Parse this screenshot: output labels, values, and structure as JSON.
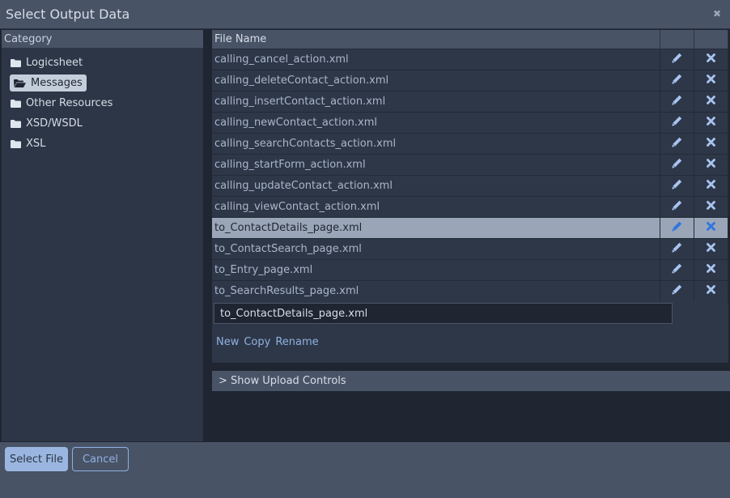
{
  "dialog": {
    "title": "Select Output Data",
    "close_icon": "close-x-icon"
  },
  "category_panel": {
    "header": "Category",
    "items": [
      {
        "label": "Logicsheet",
        "icon": "folder-icon",
        "active": false
      },
      {
        "label": "Messages",
        "icon": "folder-open-icon",
        "active": true
      },
      {
        "label": "Other Resources",
        "icon": "folder-icon",
        "active": false
      },
      {
        "label": "XSD/WSDL",
        "icon": "folder-icon",
        "active": false
      },
      {
        "label": "XSL",
        "icon": "folder-icon",
        "active": false
      }
    ]
  },
  "file_table": {
    "columns": [
      "File Name",
      "",
      ""
    ],
    "rows": [
      {
        "name": "calling_cancel_action.xml",
        "selected": false
      },
      {
        "name": "calling_deleteContact_action.xml",
        "selected": false
      },
      {
        "name": "calling_insertContact_action.xml",
        "selected": false
      },
      {
        "name": "calling_newContact_action.xml",
        "selected": false
      },
      {
        "name": "calling_searchContacts_action.xml",
        "selected": false
      },
      {
        "name": "calling_startForm_action.xml",
        "selected": false
      },
      {
        "name": "calling_updateContact_action.xml",
        "selected": false
      },
      {
        "name": "calling_viewContact_action.xml",
        "selected": false
      },
      {
        "name": "to_ContactDetails_page.xml",
        "selected": true
      },
      {
        "name": "to_ContactSearch_page.xml",
        "selected": false
      },
      {
        "name": "to_Entry_page.xml",
        "selected": false
      },
      {
        "name": "to_SearchResults_page.xml",
        "selected": false
      }
    ],
    "row_icons": {
      "edit": "pencil-icon",
      "delete": "x-icon"
    }
  },
  "editor": {
    "filename_value": "to_ContactDetails_page.xml",
    "actions": [
      "New",
      "Copy",
      "Rename"
    ]
  },
  "upload": {
    "label": "> Show Upload Controls"
  },
  "footer": {
    "select_label": "Select File",
    "cancel_label": "Cancel"
  },
  "colors": {
    "accent": "#9ab6e0",
    "link": "#8fb1e0",
    "selected_row": "#9aa6b8",
    "icon_blue": "#a8c4f0",
    "icon_blue_selected": "#2f74e0"
  }
}
